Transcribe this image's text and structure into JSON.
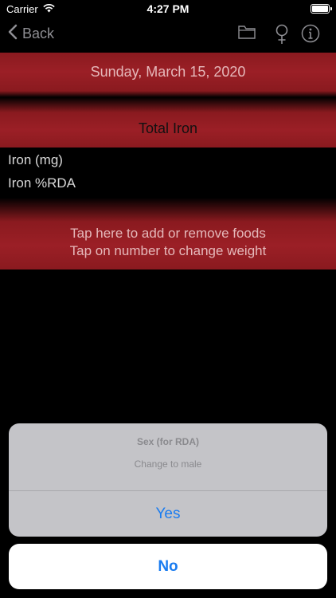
{
  "status_bar": {
    "carrier": "Carrier",
    "time": "4:27 PM"
  },
  "nav": {
    "back_label": "Back",
    "icons": [
      "folder-icon",
      "female-symbol-icon",
      "info-icon"
    ]
  },
  "date_label": "Sunday, March 15, 2020",
  "section_title": "Total Iron",
  "rows": [
    {
      "label": "Iron (mg)"
    },
    {
      "label": "Iron %RDA"
    }
  ],
  "instructions": {
    "line1": "Tap here to add or remove foods",
    "line2": "Tap on number to change weight"
  },
  "action_sheet": {
    "title": "Sex (for RDA)",
    "message": "Change to male",
    "confirm_label": "Yes",
    "cancel_label": "No"
  },
  "colors": {
    "accent_red": "#9b1f26",
    "action_blue": "#1a7cf0"
  }
}
